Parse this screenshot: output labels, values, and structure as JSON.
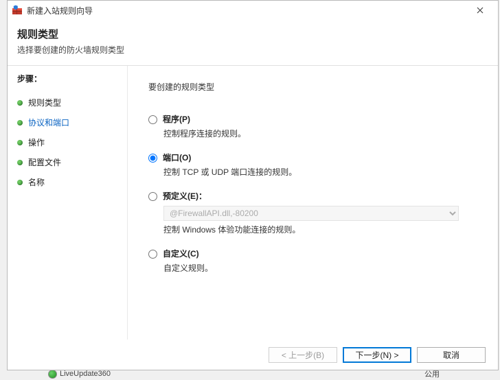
{
  "window": {
    "title": "新建入站规则向导"
  },
  "header": {
    "title": "规则类型",
    "subtitle": "选择要创建的防火墙规则类型"
  },
  "steps": {
    "title": "步骤：",
    "items": [
      {
        "label": "规则类型",
        "active": false
      },
      {
        "label": "协议和端口",
        "active": true
      },
      {
        "label": "操作",
        "active": false
      },
      {
        "label": "配置文件",
        "active": false
      },
      {
        "label": "名称",
        "active": false
      }
    ]
  },
  "content": {
    "prompt": "要创建的规则类型",
    "options": {
      "program": {
        "label": "程序(P)",
        "desc": "控制程序连接的规则。"
      },
      "port": {
        "label": "端口(O)",
        "desc": "控制 TCP 或 UDP 端口连接的规则。"
      },
      "predefined": {
        "label": "预定义(E)：",
        "selected": "@FirewallAPI.dll,-80200",
        "desc": "控制 Windows 体验功能连接的规则。"
      },
      "custom": {
        "label": "自定义(C)",
        "desc": "自定义规则。"
      }
    },
    "selected": "port"
  },
  "footer": {
    "back": "< 上一步(B)",
    "next": "下一步(N) >",
    "cancel": "取消"
  },
  "background": {
    "row_label": "LiveUpdate360",
    "row_col": "公用"
  }
}
